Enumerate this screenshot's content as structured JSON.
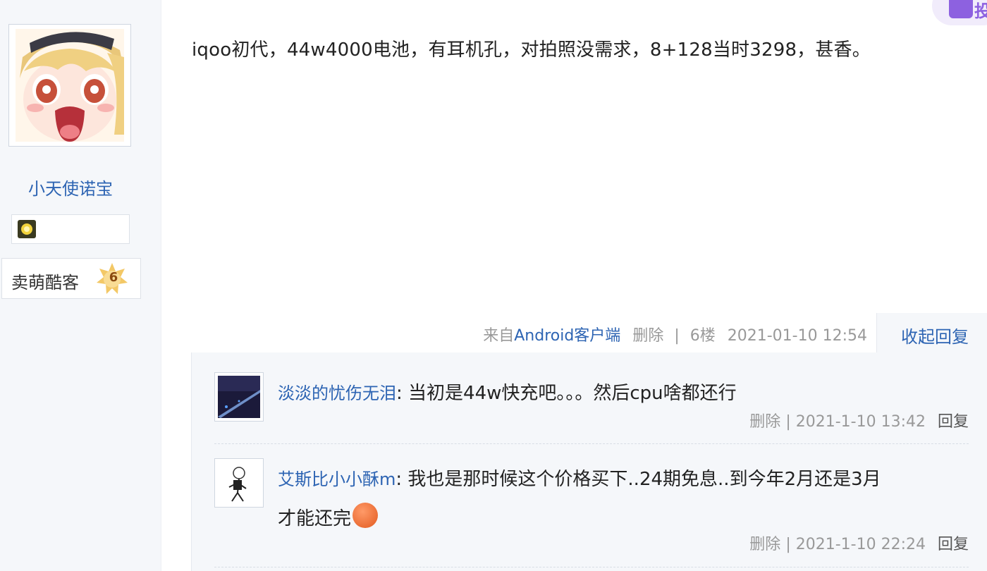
{
  "author": {
    "name": "小天使诺宝",
    "title": "卖萌酷客",
    "title_level": "6"
  },
  "corner_tag": "投",
  "post": {
    "content": "iqoo初代，44w4000电池，有耳机孔，对拍照没需求，8+128当时3298，甚香。",
    "source_prefix": "来自",
    "source_client": "Android客户端",
    "delete_label": "删除",
    "divider": "|",
    "floor": "6楼",
    "datetime": "2021-01-10 12:54",
    "collapse_label": "收起回复"
  },
  "comments": [
    {
      "user": "淡淡的忧伤无泪",
      "separator": ":",
      "text": "当初是44w快充吧。。。然后cpu啥都还行",
      "delete_label": "删除",
      "divider": "|",
      "datetime": "2021-1-10 13:42",
      "reply_label": "回复"
    },
    {
      "user": "艾斯比小小酥m",
      "separator": ":",
      "text": "我也是那时候这个价格买下..24期免息..到今年2月还是3月才能还完",
      "delete_label": "删除",
      "divider": "|",
      "datetime": "2021-1-10 22:24",
      "reply_label": "回复"
    }
  ],
  "colors": {
    "link": "#2d64b3",
    "meta": "#999999",
    "panel_bg": "#f5f7fa"
  }
}
